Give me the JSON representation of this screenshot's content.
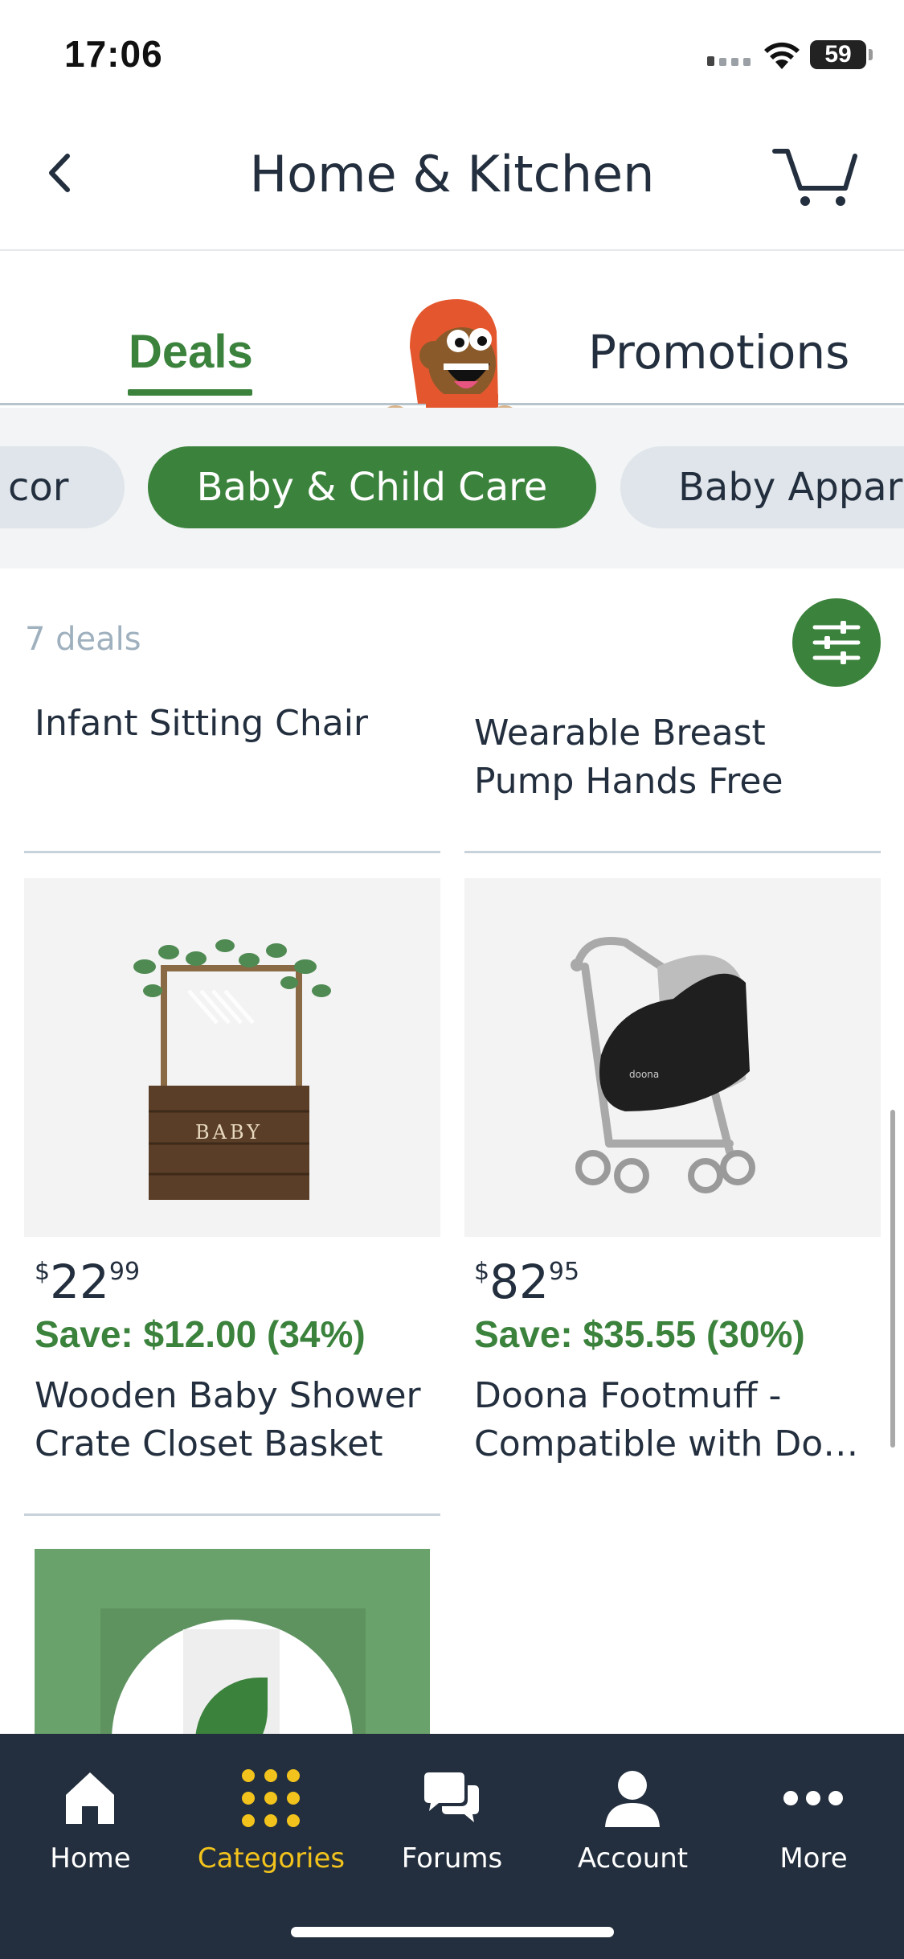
{
  "status_bar": {
    "time": "17:06",
    "battery": "59"
  },
  "header": {
    "title": "Home & Kitchen"
  },
  "tabs": {
    "deals": "Deals",
    "promotions": "Promotions"
  },
  "chips": {
    "prev": "cor",
    "active": "Baby & Child Care",
    "next": "Baby Appar"
  },
  "deals_count": "7 deals",
  "partial_titles": {
    "left": "Infant Sitting Chair",
    "right_line1": "Wearable Breast",
    "right_line2": "Pump Hands Free"
  },
  "products": [
    {
      "price_currency": "$",
      "price_whole": "22",
      "price_fraction": "99",
      "save": "Save: $12.00 (34%)",
      "title_line1": "Wooden Baby Shower",
      "title_line2": "Crate Closet Basket",
      "image_label": "BABY"
    },
    {
      "price_currency": "$",
      "price_whole": "82",
      "price_fraction": "95",
      "save": "Save: $35.55 (30%)",
      "title_line1": "Doona Footmuff -",
      "title_line2": "Compatible with Do…",
      "image_label": "doona"
    }
  ],
  "bottom_nav": [
    {
      "label": "Home",
      "icon": "home-icon",
      "active": false
    },
    {
      "label": "Categories",
      "icon": "grid-dots-icon",
      "active": true
    },
    {
      "label": "Forums",
      "icon": "chat-bubbles-icon",
      "active": false
    },
    {
      "label": "Account",
      "icon": "person-icon",
      "active": false
    },
    {
      "label": "More",
      "icon": "more-dots-icon",
      "active": false
    }
  ],
  "colors": {
    "accent_green": "#3b823c",
    "nav_bg": "#232f3e",
    "active_nav": "#f2c31c"
  }
}
